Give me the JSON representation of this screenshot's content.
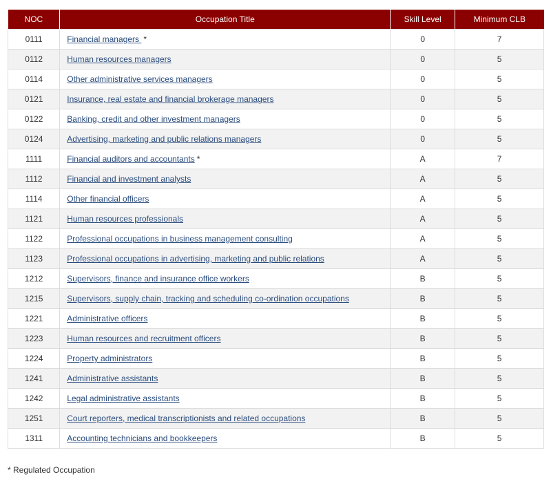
{
  "table": {
    "headers": {
      "noc": "NOC",
      "title": "Occupation Title",
      "skill": "Skill Level",
      "clb": "Minimum CLB"
    },
    "rows": [
      {
        "noc": "0111",
        "title": "Financial managers ",
        "mark": "*",
        "skill": "0",
        "clb": "7"
      },
      {
        "noc": "0112",
        "title": "Human resources managers",
        "mark": "",
        "skill": "0",
        "clb": "5"
      },
      {
        "noc": "0114",
        "title": "Other administrative services managers",
        "mark": "",
        "skill": "0",
        "clb": "5"
      },
      {
        "noc": "0121",
        "title": "Insurance, real estate and financial brokerage managers",
        "mark": "",
        "skill": "0",
        "clb": "5"
      },
      {
        "noc": "0122",
        "title": "Banking, credit and other investment managers",
        "mark": "",
        "skill": "0",
        "clb": "5"
      },
      {
        "noc": "0124",
        "title": "Advertising, marketing and public relations managers",
        "mark": "",
        "skill": "0",
        "clb": "5"
      },
      {
        "noc": "1111",
        "title": "Financial auditors and accountants",
        "mark": "*",
        "skill": "A",
        "clb": "7"
      },
      {
        "noc": "1112",
        "title": "Financial and investment analysts",
        "mark": "",
        "skill": "A",
        "clb": "5"
      },
      {
        "noc": "1114",
        "title": "Other financial officers",
        "mark": "",
        "skill": "A",
        "clb": "5"
      },
      {
        "noc": "1121",
        "title": "Human resources professionals",
        "mark": "",
        "skill": "A",
        "clb": "5"
      },
      {
        "noc": "1122",
        "title": "Professional occupations in business management consulting",
        "mark": "",
        "skill": "A",
        "clb": "5"
      },
      {
        "noc": "1123",
        "title": "Professional occupations in advertising, marketing and public relations",
        "mark": "",
        "skill": "A",
        "clb": "5"
      },
      {
        "noc": "1212",
        "title": "Supervisors, finance and insurance office workers",
        "mark": "",
        "skill": "B",
        "clb": "5"
      },
      {
        "noc": "1215",
        "title": "Supervisors, supply chain, tracking and scheduling co-ordination occupations",
        "mark": "",
        "skill": "B",
        "clb": "5"
      },
      {
        "noc": "1221",
        "title": "Administrative officers",
        "mark": "",
        "skill": "B",
        "clb": "5"
      },
      {
        "noc": "1223",
        "title": "Human resources and recruitment officers",
        "mark": "",
        "skill": "B",
        "clb": "5"
      },
      {
        "noc": "1224",
        "title": "Property administrators",
        "mark": "",
        "skill": "B",
        "clb": "5"
      },
      {
        "noc": "1241",
        "title": "Administrative assistants",
        "mark": "",
        "skill": "B",
        "clb": "5"
      },
      {
        "noc": "1242",
        "title": "Legal administrative assistants",
        "mark": "",
        "skill": "B",
        "clb": "5"
      },
      {
        "noc": "1251",
        "title": "Court reporters, medical transcriptionists and related occupations",
        "mark": "",
        "skill": "B",
        "clb": "5"
      },
      {
        "noc": "1311",
        "title": "Accounting technicians and bookkeepers",
        "mark": "",
        "skill": "B",
        "clb": "5"
      }
    ]
  },
  "footnote": "* Regulated Occupation",
  "colors": {
    "header_bg": "#8b0000",
    "link": "#2b4d7e",
    "stripe": "#f2f2f2"
  }
}
